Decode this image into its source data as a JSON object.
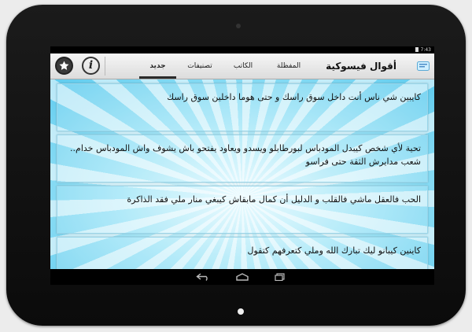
{
  "status_bar": {
    "time": "7:43"
  },
  "app": {
    "title": "أقوال فيسوكية"
  },
  "tabs": [
    {
      "label": "المفظلة"
    },
    {
      "label": "الكاتب"
    },
    {
      "label": "تصنيفات"
    },
    {
      "label": "جديد"
    }
  ],
  "quotes": [
    {
      "text": "كايبين شي ناس أنت داخل سوق راسك و حتى هوما داخلين سوق راسك"
    },
    {
      "text": "تحية لأي شخص كيبدل المودباس لبورطابلو ويسدو ويعاود يفتحو باش يشوف واش المودباس خدام.. شعب مدايرش الثقة حتى فراسو"
    },
    {
      "text": "الحب فالعقل ماشي فالقلب و الدليل أن كمال مابقاش كيبغي منار ملي فقد الذاكرة"
    },
    {
      "text": "كاينين كيبانو ليك تبارك الله وملي كتعرفهم كتقول"
    }
  ],
  "colors": {
    "action_bar": "#e8e8e8",
    "content_light": "#e9fbff",
    "content_dark": "#5ecbee",
    "card_border": "#9ad6ea",
    "device": "#111111"
  },
  "icons": {
    "favorites_button": "star-icon",
    "info_button": "info-icon",
    "logo": "app-logo-icon",
    "nav_back": "back-arrow-icon",
    "nav_home": "home-icon",
    "nav_recent": "recent-apps-icon"
  }
}
